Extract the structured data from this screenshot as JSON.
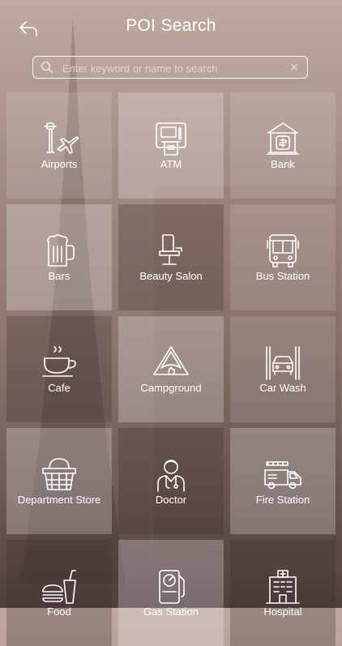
{
  "header": {
    "title": "POI Search"
  },
  "search": {
    "placeholder": "Enter keyword or name to search",
    "value": ""
  },
  "categories": [
    {
      "label": "Airports",
      "icon": "airport-icon"
    },
    {
      "label": "ATM",
      "icon": "atm-icon"
    },
    {
      "label": "Bank",
      "icon": "bank-icon"
    },
    {
      "label": "Bars",
      "icon": "beer-mug-icon"
    },
    {
      "label": "Beauty Salon",
      "icon": "salon-chair-icon"
    },
    {
      "label": "Bus Station",
      "icon": "bus-icon"
    },
    {
      "label": "Cafe",
      "icon": "coffee-cup-icon"
    },
    {
      "label": "Campground",
      "icon": "tent-icon"
    },
    {
      "label": "Car Wash",
      "icon": "car-wash-icon"
    },
    {
      "label": "Department Store",
      "icon": "shopping-basket-icon"
    },
    {
      "label": "Doctor",
      "icon": "doctor-icon"
    },
    {
      "label": "Fire Station",
      "icon": "fire-truck-icon"
    },
    {
      "label": "Food",
      "icon": "burger-drink-icon"
    },
    {
      "label": "Gas Station",
      "icon": "gas-pump-icon"
    },
    {
      "label": "Hospital",
      "icon": "hospital-icon"
    }
  ]
}
